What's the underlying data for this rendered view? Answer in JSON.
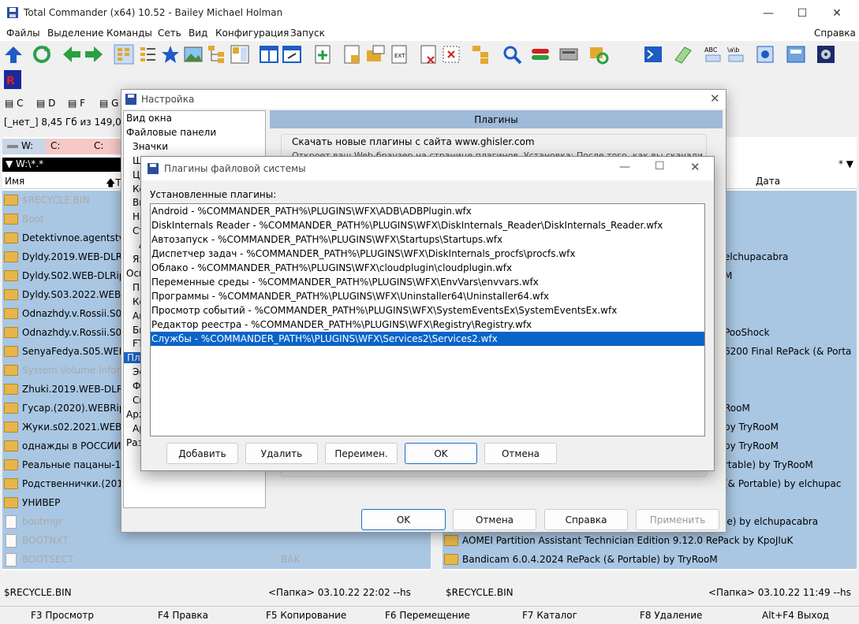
{
  "window": {
    "title": "Total Commander (x64) 10.52 - Bailey Michael Holman"
  },
  "menu": [
    "Файлы",
    "Выделение",
    "Команды",
    "Сеть",
    "Вид",
    "Конфигурация",
    "Запуск"
  ],
  "menu_help": "Справка",
  "drives": [
    "C",
    "D",
    "F",
    "G"
  ],
  "free_space": "[_нет_]  8,45 Гб из 149,04",
  "left_panel": {
    "tabs": [
      "W:",
      "C:",
      "C:"
    ],
    "path": "W:\\*.*",
    "col_name": "Имя",
    "col_ext": "Т",
    "files": [
      {
        "name": "$RECYCLE.BIN",
        "type": "folder",
        "style": "gray"
      },
      {
        "name": "Boot",
        "type": "folder",
        "style": "gray"
      },
      {
        "name": "Detektivnoe.agentstvo",
        "type": "folder",
        "style": ""
      },
      {
        "name": "Dyldy.2019.WEB-DLRip",
        "type": "folder",
        "style": ""
      },
      {
        "name": "Dyldy.S02.WEB-DLRip",
        "type": "folder",
        "style": ""
      },
      {
        "name": "Dyldy.S03.2022.WEB-D",
        "type": "folder",
        "style": ""
      },
      {
        "name": "Odnazhdy.v.Rossii.S06",
        "type": "folder",
        "style": ""
      },
      {
        "name": "Odnazhdy.v.Rossii.S09",
        "type": "folder",
        "style": ""
      },
      {
        "name": "SenyaFedya.S05.WEB-D",
        "type": "folder",
        "style": ""
      },
      {
        "name": "System Volume Inform",
        "type": "folder",
        "style": "gray"
      },
      {
        "name": "Zhuki.2019.WEB-DLRip",
        "type": "folder",
        "style": ""
      },
      {
        "name": "Гусар.(2020).WEBRip.",
        "type": "folder",
        "style": ""
      },
      {
        "name": "Жуки.s02.2021.WEB-D",
        "type": "folder",
        "style": ""
      },
      {
        "name": "однажды в РОССИИ",
        "type": "folder",
        "style": ""
      },
      {
        "name": "Реальные пацаны-13",
        "type": "folder",
        "style": ""
      },
      {
        "name": "Родственнички.(2016)",
        "type": "folder",
        "style": ""
      },
      {
        "name": "УНИВЕР",
        "type": "folder",
        "style": ""
      },
      {
        "name": "bootmgr",
        "type": "file",
        "style": "gray"
      },
      {
        "name": "BOOTNXT",
        "type": "file",
        "style": "gray"
      },
      {
        "name": "BOOTSECT",
        "type": "file",
        "style": "gray",
        "ext": "BAK"
      }
    ]
  },
  "right_panel": {
    "star": "*",
    "col_date": "Дата",
    "files": [
      {
        "row": 3,
        "name": "elchupacabra"
      },
      {
        "row": 4,
        "name": "M"
      },
      {
        "row": 7,
        "name": "PooShock"
      },
      {
        "row": 8,
        "name": "6200 Final RePack (& Porta"
      },
      {
        "row": 11,
        "name": "RooM"
      },
      {
        "row": 12,
        "name": "by TryRooM"
      },
      {
        "row": 13,
        "name": "by TryRooM"
      },
      {
        "row": 14,
        "name": "rtable) by TryRooM"
      },
      {
        "row": 15,
        "name": "(& Portable) by elchupac"
      },
      {
        "row": 17,
        "name": "le) by elchupacabra"
      },
      {
        "row": 18,
        "name": "AOMEI Partition Assistant Technician Edition 9.12.0 RePack by KpoJIuK",
        "folder": true
      },
      {
        "row": 19,
        "name": "Bandicam 6.0.4.2024 RePack (& Portable) by TryRooM",
        "folder": true
      }
    ]
  },
  "status": {
    "left_name": "$RECYCLE.BIN",
    "left_info": "<Папка> 03.10.22 22:02  --hs",
    "right_name": "$RECYCLE.BIN",
    "right_info": "<Папка> 03.10.22 11:49  --hs"
  },
  "fkeys": [
    "F3 Просмотр",
    "F4 Правка",
    "F5 Копирование",
    "F6 Перемещение",
    "F7 Каталог",
    "F8 Удаление",
    "Alt+F4 Выход"
  ],
  "settings": {
    "title": "Настройка",
    "tree": [
      {
        "label": "Вид окна",
        "indent": 0
      },
      {
        "label": "Файловые панели",
        "indent": 0
      },
      {
        "label": "Значки",
        "indent": 1
      },
      {
        "label": "Ш",
        "indent": 1
      },
      {
        "label": "Ц",
        "indent": 1
      },
      {
        "label": "Ко",
        "indent": 1
      },
      {
        "label": "Вк",
        "indent": 1
      },
      {
        "label": "На",
        "indent": 1
      },
      {
        "label": "Ст",
        "indent": 1
      },
      {
        "label": "А",
        "indent": 2
      },
      {
        "label": "Яз",
        "indent": 1
      },
      {
        "label": "Осн",
        "indent": 0
      },
      {
        "label": "Пр",
        "indent": 1
      },
      {
        "label": "Ко",
        "indent": 1
      },
      {
        "label": "Ав",
        "indent": 1
      },
      {
        "label": "Бы",
        "indent": 1
      },
      {
        "label": "FT",
        "indent": 1
      },
      {
        "label": "Пла",
        "indent": 1,
        "selected": true
      },
      {
        "label": "Эс",
        "indent": 1
      },
      {
        "label": "Фа",
        "indent": 1
      },
      {
        "label": "Сп",
        "indent": 1
      },
      {
        "label": "Арх",
        "indent": 0
      },
      {
        "label": "Ар",
        "indent": 1
      },
      {
        "label": "Раз",
        "indent": 0
      }
    ],
    "section": "Плагины",
    "download_text": "Скачать новые плагины с сайта www.ghisler.com",
    "info_text": "Откроет ваш Web-браузер на странице плагинов. Установка: После того, как вы скачали",
    "buttons": {
      "ok": "OK",
      "cancel": "Отмена",
      "help": "Справка",
      "apply": "Применить"
    }
  },
  "fs_dialog": {
    "title": "Плагины файловой системы",
    "installed_label": "Установленные плагины:",
    "plugins": [
      "Android  -  %COMMANDER_PATH%\\PLUGINS\\WFX\\ADB\\ADBPlugin.wfx",
      "DiskInternals Reader  -  %COMMANDER_PATH%\\PLUGINS\\WFX\\DiskInternals_Reader\\DiskInternals_Reader.wfx",
      "Автозапуск  -  %COMMANDER_PATH%\\PLUGINS\\WFX\\Startups\\Startups.wfx",
      "Диспетчер задач  -  %COMMANDER_PATH%\\PLUGINS\\WFX\\DiskInternals_procfs\\procfs.wfx",
      "Облако  -  %COMMANDER_PATH%\\PLUGINS\\WFX\\cloudplugin\\cloudplugin.wfx",
      "Переменные среды  -  %COMMANDER_PATH%\\PLUGINS\\WFX\\EnvVars\\envvars.wfx",
      "Программы  -  %COMMANDER_PATH%\\PLUGINS\\WFX\\Uninstaller64\\Uninstaller64.wfx",
      "Просмотр событий  -  %COMMANDER_PATH%\\PLUGINS\\WFX\\SystemEventsEx\\SystemEventsEx.wfx",
      "Редактор реестра  -  %COMMANDER_PATH%\\PLUGINS\\WFX\\Registry\\Registry.wfx",
      "Службы  -  %COMMANDER_PATH%\\PLUGINS\\WFX\\Services2\\Services2.wfx"
    ],
    "selected_index": 9,
    "buttons": {
      "add": "Добавить",
      "remove": "Удалить",
      "rename": "Переимен.",
      "ok": "OK",
      "cancel": "Отмена"
    }
  }
}
